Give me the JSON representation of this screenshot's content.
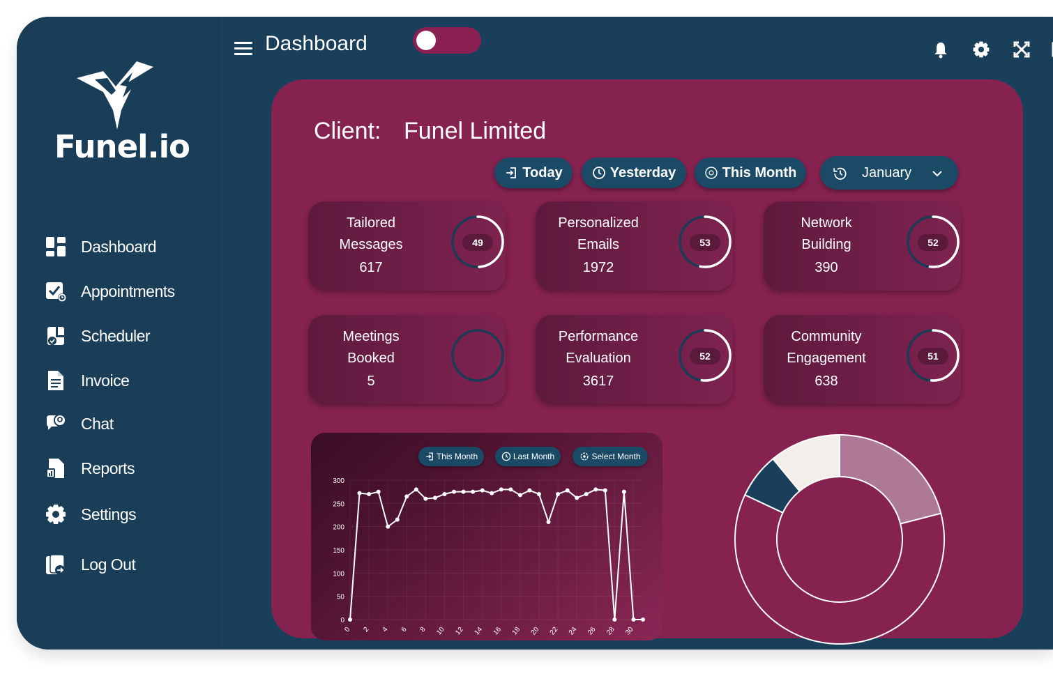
{
  "brand": {
    "name": "Funel.io"
  },
  "sidebar": {
    "items": [
      {
        "label": "Dashboard",
        "icon": "dashboard-icon"
      },
      {
        "label": "Appointments",
        "icon": "appointments-icon"
      },
      {
        "label": "Scheduler",
        "icon": "scheduler-icon"
      },
      {
        "label": "Invoice",
        "icon": "invoice-icon"
      },
      {
        "label": "Chat",
        "icon": "chat-icon"
      },
      {
        "label": "Reports",
        "icon": "reports-icon"
      },
      {
        "label": "Settings",
        "icon": "gear-icon"
      },
      {
        "label": "Log Out",
        "icon": "logout-icon"
      }
    ]
  },
  "header": {
    "title": "Dashboard",
    "icons": [
      "bell-icon",
      "gear-icon",
      "fullscreen-icon",
      "logout-icon"
    ]
  },
  "client": {
    "label": "Client:",
    "name": "Funel Limited"
  },
  "filters": {
    "today": "Today",
    "yesterday": "Yesterday",
    "this_month": "This Month",
    "month_selected": "January"
  },
  "stats": [
    {
      "title1": "Tailored",
      "title2": "Messages",
      "value": "617",
      "percent": 49,
      "badge": "49"
    },
    {
      "title1": "Personalized",
      "title2": "Emails",
      "value": "1972",
      "percent": 53,
      "badge": "53"
    },
    {
      "title1": "Network",
      "title2": "Building",
      "value": "390",
      "percent": 52,
      "badge": "52"
    },
    {
      "title1": "Meetings",
      "title2": "Booked",
      "value": "5",
      "percent": 0,
      "badge": ""
    },
    {
      "title1": "Performance",
      "title2": "Evaluation",
      "value": "3617",
      "percent": 52,
      "badge": "52"
    },
    {
      "title1": "Community",
      "title2": "Engagement",
      "value": "638",
      "percent": 51,
      "badge": "51"
    }
  ],
  "chart_filters": {
    "this_month": "This Month",
    "last_month": "Last Month",
    "select_month": "Select Month"
  },
  "colors": {
    "background": "#193f5a",
    "panel": "#852250",
    "accent": "#1b4a66",
    "ring": "#ffffff",
    "ring_track": "#1b3a55"
  },
  "chart_data": [
    {
      "type": "line",
      "x": [
        0,
        1,
        2,
        3,
        4,
        5,
        6,
        7,
        8,
        9,
        10,
        11,
        12,
        13,
        14,
        15,
        16,
        17,
        18,
        19,
        20,
        21,
        22,
        23,
        24,
        25,
        26,
        27,
        28,
        29,
        30,
        31
      ],
      "series": [
        {
          "values": [
            0,
            272,
            270,
            275,
            200,
            215,
            265,
            280,
            260,
            262,
            270,
            275,
            275,
            275,
            278,
            272,
            280,
            280,
            268,
            278,
            270,
            210,
            270,
            278,
            262,
            270,
            280,
            278,
            0,
            275,
            0,
            0
          ]
        }
      ],
      "xticks": [
        0,
        2,
        4,
        6,
        8,
        10,
        12,
        14,
        16,
        18,
        20,
        22,
        24,
        26,
        28,
        30
      ],
      "yticks": [
        0,
        50,
        100,
        150,
        200,
        250,
        300
      ],
      "ylim": [
        0,
        300
      ],
      "xlim": [
        0,
        31
      ],
      "grid": true
    },
    {
      "type": "pie",
      "variant": "donut",
      "slices": [
        {
          "value": 21,
          "color": "#ad7997"
        },
        {
          "value": 61,
          "color": "#852250"
        },
        {
          "value": 7,
          "color": "#193f5a"
        },
        {
          "value": 11,
          "color": "#f2efea"
        }
      ]
    }
  ]
}
